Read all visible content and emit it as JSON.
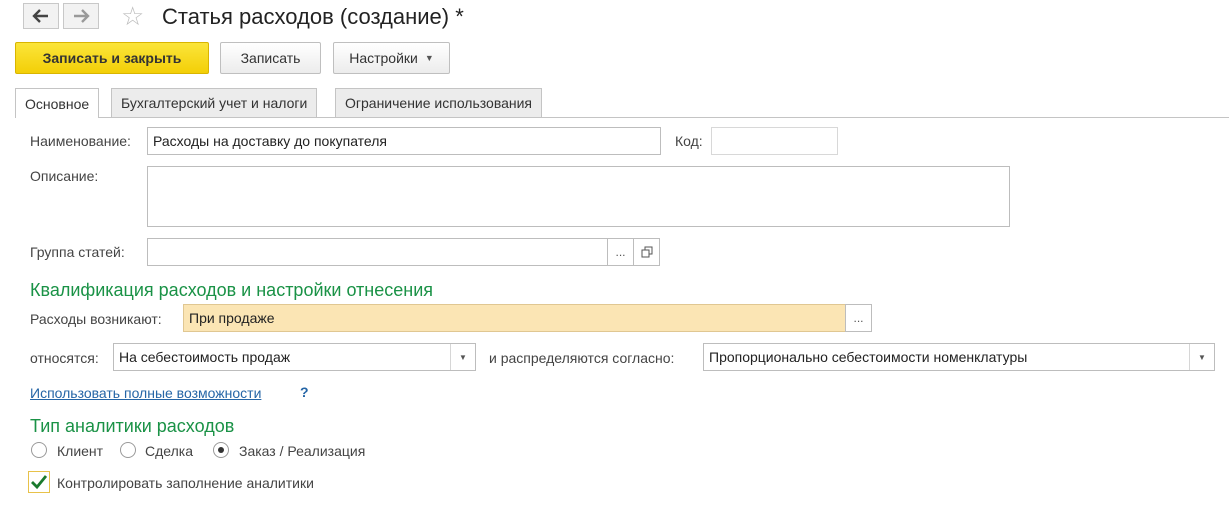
{
  "header": {
    "back_icon": "arrow-left",
    "forward_icon": "arrow-right",
    "favorite_icon": "star-outline",
    "title": "Статья расходов (создание) *"
  },
  "toolbar": {
    "save_close_label": "Записать и закрыть",
    "save_label": "Записать",
    "settings_label": "Настройки"
  },
  "tabs": [
    {
      "label": "Основное",
      "active": true
    },
    {
      "label": "Бухгалтерский учет и налоги",
      "active": false
    },
    {
      "label": "Ограничение использования",
      "active": false
    }
  ],
  "form": {
    "name_label": "Наименование:",
    "name_value": "Расходы на доставку до покупателя",
    "code_label": "Код:",
    "code_value": "",
    "description_label": "Описание:",
    "description_value": "",
    "group_label": "Группа статей:",
    "group_value": "",
    "ellipsis": "...",
    "open_icon": "open-copy-icon"
  },
  "qualification": {
    "heading": "Квалификация расходов и настройки отнесения",
    "arise_label": "Расходы возникают:",
    "arise_value": "При продаже",
    "relate_label": "относятся:",
    "relate_value": "На себестоимость продаж",
    "distribute_label": "и распределяются согласно:",
    "distribute_value": "Пропорционально себестоимости номенклатуры",
    "full_features_link": "Использовать полные возможности",
    "help_mark": "?"
  },
  "analytics": {
    "heading": "Тип аналитики расходов",
    "options": [
      {
        "label": "Клиент",
        "selected": false
      },
      {
        "label": "Сделка",
        "selected": false
      },
      {
        "label": "Заказ / Реализация",
        "selected": true
      }
    ],
    "control_label": "Контролировать заполнение аналитики",
    "control_checked": true
  },
  "colors": {
    "accent_yellow": "#f5d20a",
    "highlight_field": "#fbe5b4",
    "section_green": "#1a9246",
    "link_blue": "#2565a6"
  }
}
